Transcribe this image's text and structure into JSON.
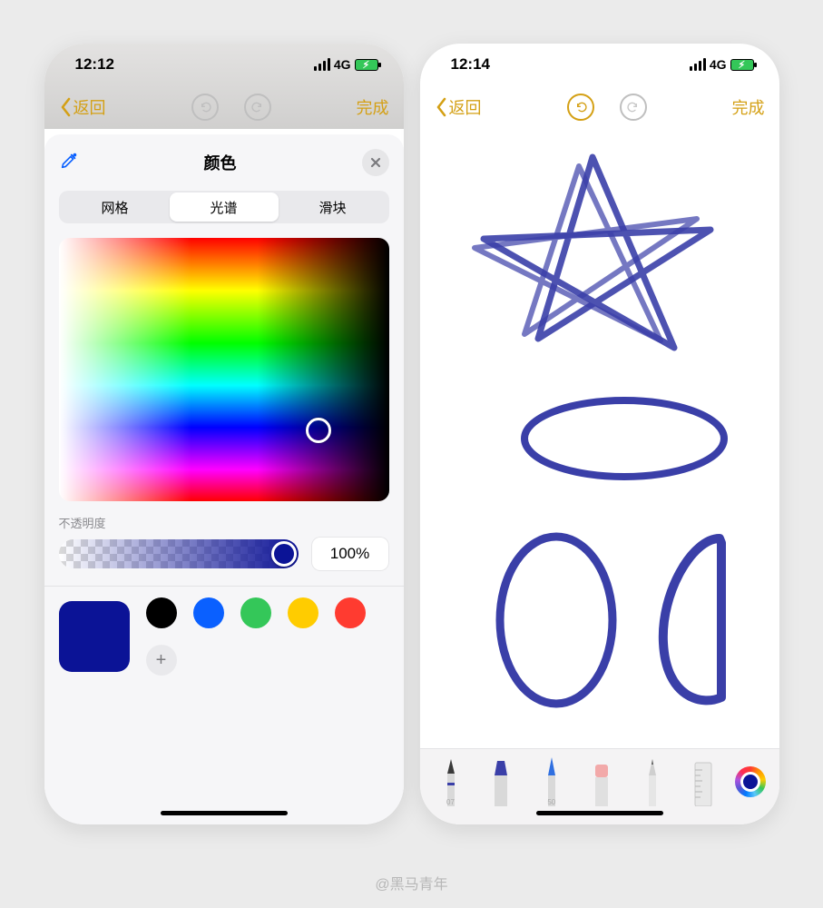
{
  "watermark": "@黑马青年",
  "left": {
    "status": {
      "time": "12:12",
      "network": "4G"
    },
    "nav": {
      "back": "返回",
      "done": "完成"
    },
    "sheet": {
      "title": "颜色",
      "tabs": {
        "grid": "网格",
        "spectrum": "光谱",
        "sliders": "滑块",
        "selected": "spectrum"
      },
      "opacity": {
        "label": "不透明度",
        "value": "100%"
      },
      "current_color": "#0b1396",
      "swatches": [
        "#000000",
        "#0a60ff",
        "#34c759",
        "#ffcc00",
        "#ff3b30"
      ]
    }
  },
  "right": {
    "status": {
      "time": "12:14",
      "network": "4G"
    },
    "nav": {
      "back": "返回",
      "done": "完成"
    },
    "tools": {
      "pen_label": "07",
      "marker_label": "",
      "highlighter_label": "50",
      "eraser_label": "",
      "pencil_label": "",
      "ruler_label": "",
      "color": "#0b1396"
    }
  }
}
